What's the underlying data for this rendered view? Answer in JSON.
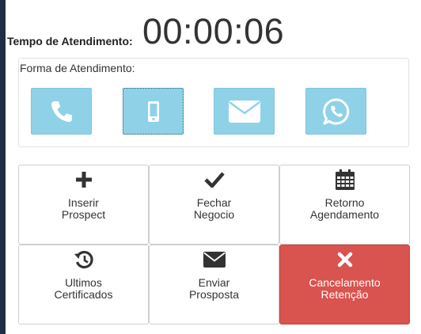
{
  "timer": {
    "label": "Tempo de Atendimento:",
    "value": "00:00:06"
  },
  "channels": {
    "title": "Forma de Atendimento:",
    "items": [
      {
        "icon": "phone-icon",
        "selected": false
      },
      {
        "icon": "mobile-icon",
        "selected": true
      },
      {
        "icon": "envelope-icon",
        "selected": false
      },
      {
        "icon": "whatsapp-icon",
        "selected": false
      }
    ],
    "color": "#8fd2e8"
  },
  "actions": [
    {
      "label": "Inserir\nProspect",
      "icon": "plus-icon"
    },
    {
      "label": "Fechar\nNegocio",
      "icon": "check-icon"
    },
    {
      "label": "Retorno\nAgendamento",
      "icon": "calendar-icon"
    },
    {
      "label": "Ultimos\nCertificados",
      "icon": "history-icon"
    },
    {
      "label": "Enviar\nProsposta",
      "icon": "envelope-icon"
    },
    {
      "label": "Cancelamento\nRetenção",
      "icon": "close-icon",
      "color": "#d9534f"
    }
  ]
}
